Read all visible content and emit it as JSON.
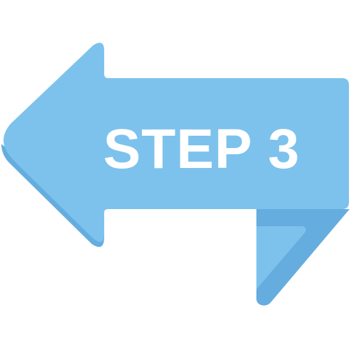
{
  "label": "STEP 3",
  "colors": {
    "arrow_light": "#7DC2ED",
    "arrow_shadow": "#65ADDE",
    "text": "#FFFFFF",
    "background": "#FFFFFF"
  },
  "icon": "left-arrow-step-icon"
}
